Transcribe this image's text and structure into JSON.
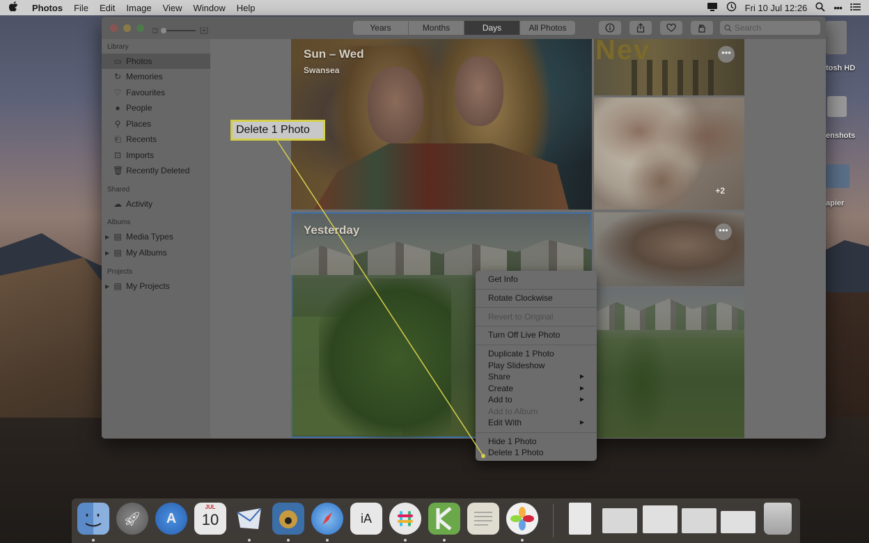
{
  "menubar": {
    "apple": "",
    "items": [
      "Photos",
      "File",
      "Edit",
      "Image",
      "View",
      "Window",
      "Help"
    ],
    "clock": "Fri 10 Jul  12:26"
  },
  "desktop": {
    "labels": [
      "tosh HD",
      "enshots",
      "apier"
    ]
  },
  "toolbar": {
    "segments": [
      "Years",
      "Months",
      "Days",
      "All Photos"
    ],
    "active_segment": "Days",
    "search_placeholder": "Search"
  },
  "sidebar": {
    "library_header": "Library",
    "library_items": [
      {
        "label": "Photos",
        "icon": "photos-icon",
        "selected": true
      },
      {
        "label": "Memories",
        "icon": "memories-icon"
      },
      {
        "label": "Favourites",
        "icon": "heart-icon"
      },
      {
        "label": "People",
        "icon": "person-icon"
      },
      {
        "label": "Places",
        "icon": "pin-icon"
      },
      {
        "label": "Recents",
        "icon": "recents-icon"
      },
      {
        "label": "Imports",
        "icon": "imports-icon"
      },
      {
        "label": "Recently Deleted",
        "icon": "trash-icon"
      }
    ],
    "shared_header": "Shared",
    "shared_items": [
      {
        "label": "Activity",
        "icon": "cloud-icon"
      }
    ],
    "albums_header": "Albums",
    "album_items": [
      {
        "label": "Media Types",
        "icon": "folder-icon"
      },
      {
        "label": "My Albums",
        "icon": "folder-icon"
      }
    ],
    "projects_header": "Projects",
    "project_items": [
      {
        "label": "My Projects",
        "icon": "folder-icon"
      }
    ]
  },
  "content": {
    "group1_title": "Sun – Wed",
    "group1_subtitle": "Swansea",
    "group2_title": "Yesterday",
    "plus_count": "+2",
    "poster_text": "Nev"
  },
  "context_menu": {
    "items": [
      {
        "label": "Get Info"
      },
      {
        "label": "Rotate Clockwise"
      },
      {
        "label": "Revert to Original",
        "disabled": true
      },
      {
        "label": "Turn Off Live Photo"
      },
      {
        "label": "Duplicate 1 Photo"
      },
      {
        "label": "Play Slideshow"
      },
      {
        "label": "Share",
        "submenu": true
      },
      {
        "label": "Create",
        "submenu": true
      },
      {
        "label": "Add to",
        "submenu": true
      },
      {
        "label": "Add to Album",
        "disabled": true
      },
      {
        "label": "Edit With",
        "submenu": true
      },
      {
        "label": "Hide 1 Photo"
      },
      {
        "label": "Delete 1 Photo"
      }
    ]
  },
  "callout": {
    "text": "Delete 1 Photo",
    "color": "#d4cf4a"
  },
  "dock": {
    "calendar_month": "JUL",
    "calendar_day": "10",
    "ia_writer": "iA",
    "apps": [
      "finder-icon",
      "launchpad-icon",
      "app-store-icon",
      "calendar-icon",
      "mail-icon",
      "tweetbot-icon",
      "safari-icon",
      "ia-writer-icon",
      "slack-icon",
      "kite-icon",
      "notes-icon",
      "photos-icon"
    ]
  }
}
